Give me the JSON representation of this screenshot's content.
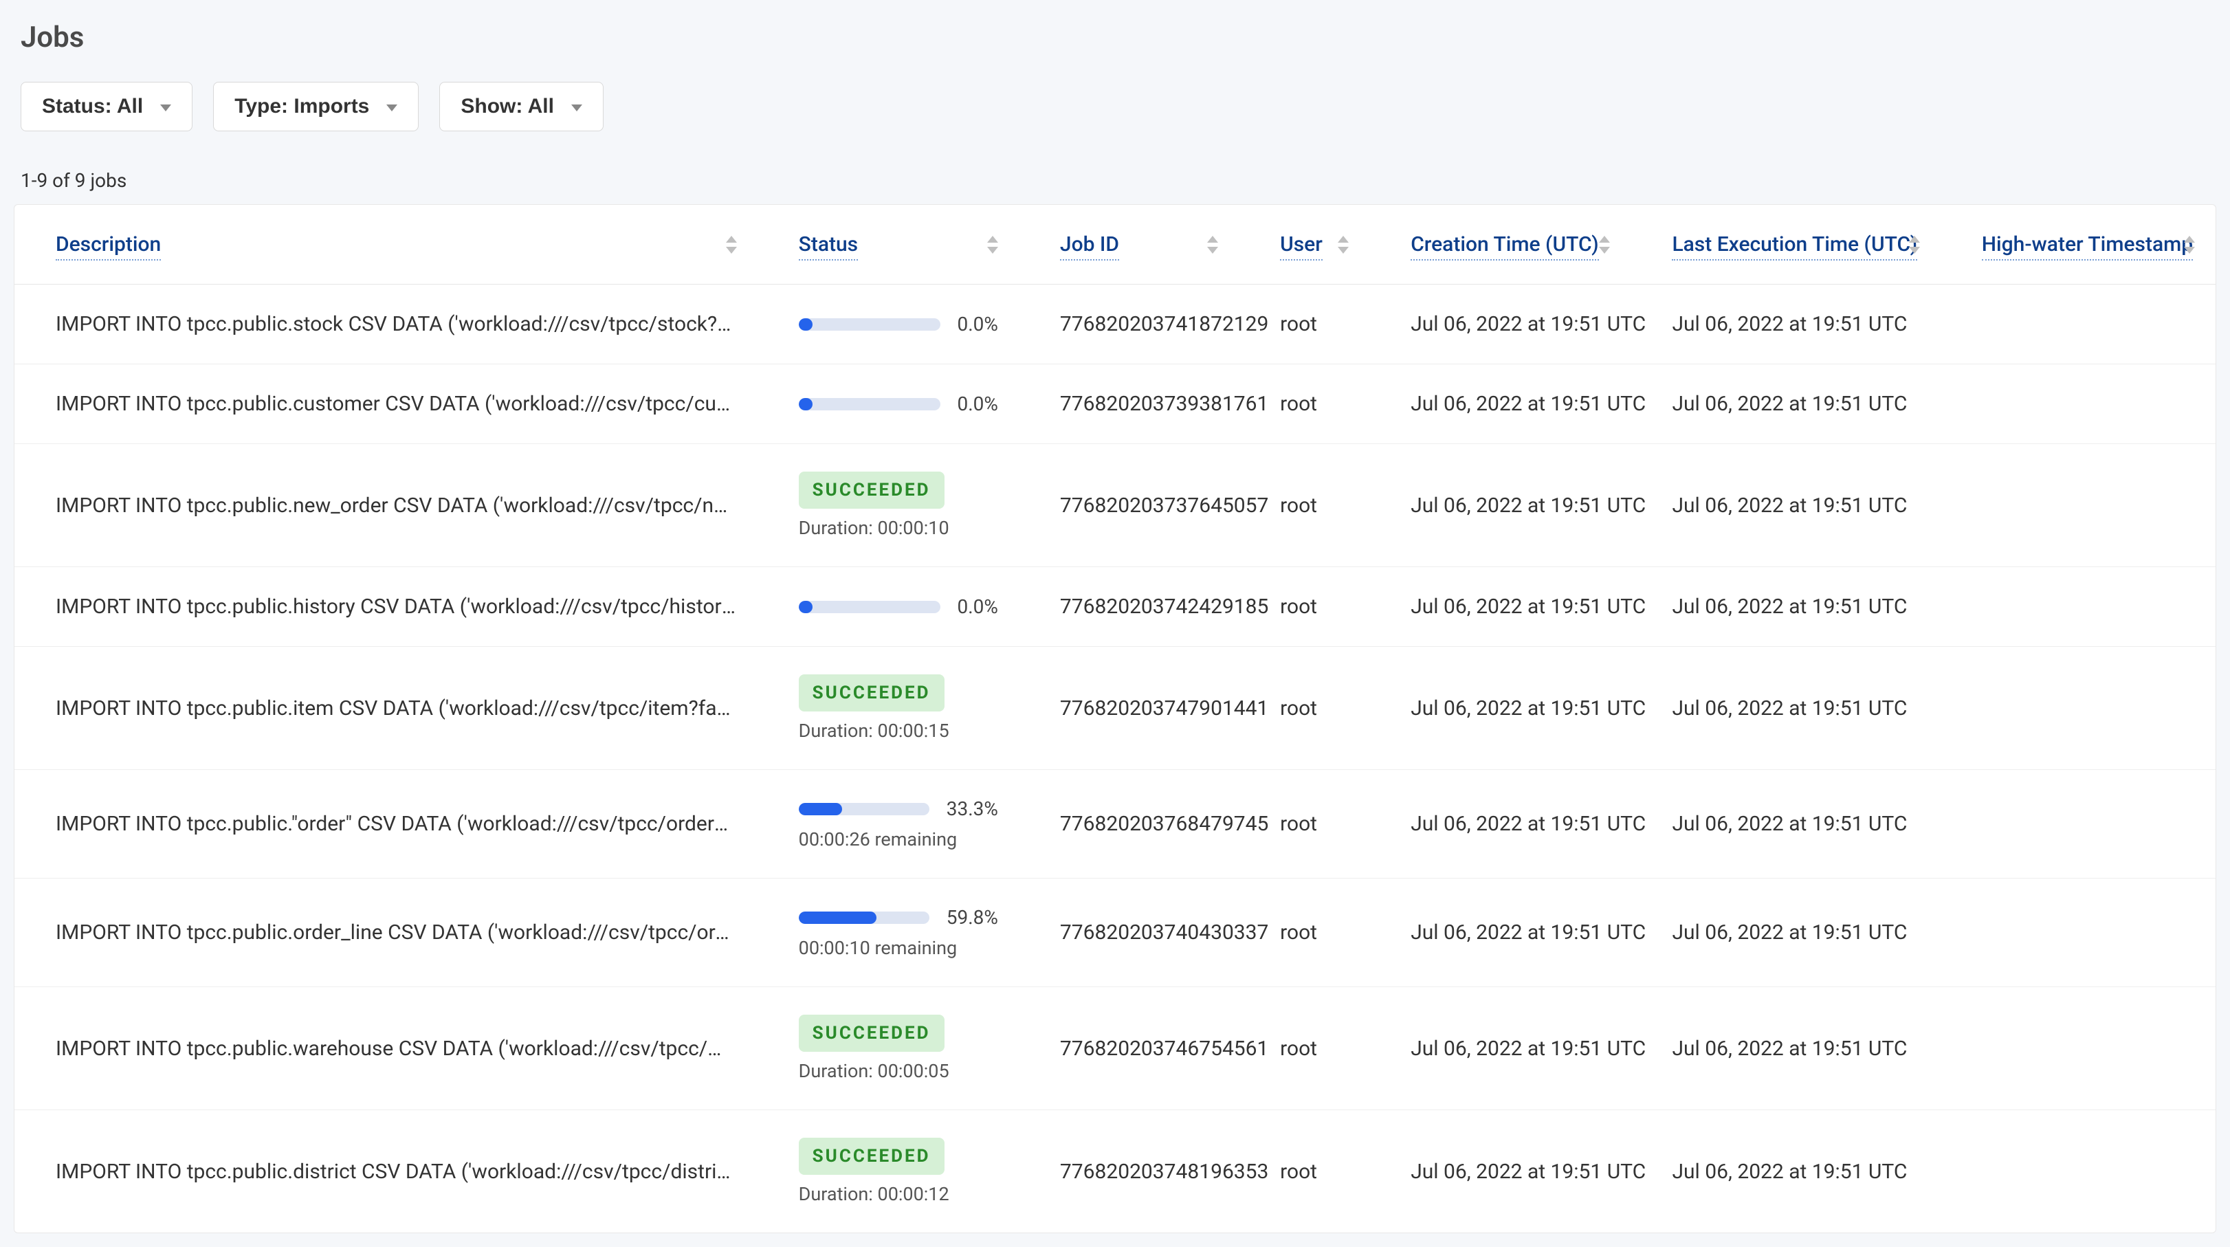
{
  "page_title": "Jobs",
  "filters": {
    "status": "Status: All",
    "type": "Type: Imports",
    "show": "Show: All"
  },
  "result_count": "1-9 of 9 jobs",
  "columns": {
    "description": "Description",
    "status": "Status",
    "job_id": "Job ID",
    "user": "User",
    "creation_time": "Creation Time (UTC)",
    "last_exec_time": "Last Execution Time (UTC)",
    "highwater": "High-water Timestamp"
  },
  "status_labels": {
    "succeeded": "SUCCEEDED",
    "duration_prefix": "Duration: ",
    "remaining_suffix": " remaining"
  },
  "rows": [
    {
      "description": "IMPORT INTO tpcc.public.stock CSV DATA ('workload:///csv/tpcc/stock?families…",
      "status_type": "progress",
      "progress_pct": 0.0,
      "pct_label": "0.0%",
      "subtext": "",
      "job_id": "776820203741872129",
      "user": "root",
      "creation_time": "Jul 06, 2022 at 19:51 UTC",
      "last_exec_time": "Jul 06, 2022 at 19:51 UTC"
    },
    {
      "description": "IMPORT INTO tpcc.public.customer CSV DATA ('workload:///csv/tpcc/customer?f…",
      "status_type": "progress",
      "progress_pct": 0.0,
      "pct_label": "0.0%",
      "subtext": "",
      "job_id": "776820203739381761",
      "user": "root",
      "creation_time": "Jul 06, 2022 at 19:51 UTC",
      "last_exec_time": "Jul 06, 2022 at 19:51 UTC"
    },
    {
      "description": "IMPORT INTO tpcc.public.new_order CSV DATA ('workload:///csv/tpcc/new_ord…",
      "status_type": "succeeded",
      "duration": "00:00:10",
      "job_id": "776820203737645057",
      "user": "root",
      "creation_time": "Jul 06, 2022 at 19:51 UTC",
      "last_exec_time": "Jul 06, 2022 at 19:51 UTC"
    },
    {
      "description": "IMPORT INTO tpcc.public.history CSV DATA ('workload:///csv/tpcc/history?famil…",
      "status_type": "progress",
      "progress_pct": 0.0,
      "pct_label": "0.0%",
      "subtext": "",
      "job_id": "776820203742429185",
      "user": "root",
      "creation_time": "Jul 06, 2022 at 19:51 UTC",
      "last_exec_time": "Jul 06, 2022 at 19:51 UTC"
    },
    {
      "description": "IMPORT INTO tpcc.public.item CSV DATA ('workload:///csv/tpcc/item?families=f…",
      "status_type": "succeeded",
      "duration": "00:00:15",
      "job_id": "776820203747901441",
      "user": "root",
      "creation_time": "Jul 06, 2022 at 19:51 UTC",
      "last_exec_time": "Jul 06, 2022 at 19:51 UTC"
    },
    {
      "description": "IMPORT INTO tpcc.public.\"order\" CSV DATA ('workload:///csv/tpcc/order?familie…",
      "status_type": "progress",
      "progress_pct": 33.3,
      "pct_label": "33.3%",
      "subtext": "00:00:26 remaining",
      "job_id": "776820203768479745",
      "user": "root",
      "creation_time": "Jul 06, 2022 at 19:51 UTC",
      "last_exec_time": "Jul 06, 2022 at 19:51 UTC"
    },
    {
      "description": "IMPORT INTO tpcc.public.order_line CSV DATA ('workload:///csv/tpcc/order_lin…",
      "status_type": "progress",
      "progress_pct": 59.8,
      "pct_label": "59.8%",
      "subtext": "00:00:10 remaining",
      "job_id": "776820203740430337",
      "user": "root",
      "creation_time": "Jul 06, 2022 at 19:51 UTC",
      "last_exec_time": "Jul 06, 2022 at 19:51 UTC"
    },
    {
      "description": "IMPORT INTO tpcc.public.warehouse CSV DATA ('workload:///csv/tpcc/warehou…",
      "status_type": "succeeded",
      "duration": "00:00:05",
      "job_id": "776820203746754561",
      "user": "root",
      "creation_time": "Jul 06, 2022 at 19:51 UTC",
      "last_exec_time": "Jul 06, 2022 at 19:51 UTC"
    },
    {
      "description": "IMPORT INTO tpcc.public.district CSV DATA ('workload:///csv/tpcc/district?famil…",
      "status_type": "succeeded",
      "duration": "00:00:12",
      "job_id": "776820203748196353",
      "user": "root",
      "creation_time": "Jul 06, 2022 at 19:51 UTC",
      "last_exec_time": "Jul 06, 2022 at 19:51 UTC"
    }
  ]
}
